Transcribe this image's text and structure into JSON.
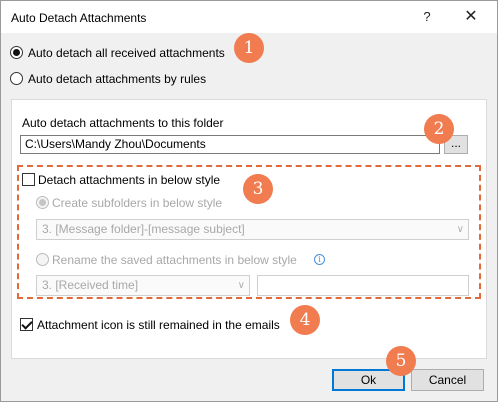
{
  "window": {
    "title": "Auto Detach Attachments",
    "help_glyph": "?",
    "close_glyph": "✕"
  },
  "options": {
    "all_received": "Auto detach all received attachments",
    "by_rules": "Auto detach attachments by rules"
  },
  "folder": {
    "label": "Auto detach attachments to this folder",
    "path": "C:\\Users\\Mandy Zhou\\Documents",
    "browse_label": "..."
  },
  "style": {
    "checkbox_label": "Detach attachments in below style",
    "create_subfolders_label": "Create subfolders in below style",
    "subfolder_select_value": "3. [Message folder]-[message subject]",
    "rename_label": "Rename the saved attachments in below style",
    "rename_select_value": "3. [Received time]",
    "rename_extra_value": ""
  },
  "icon_option": {
    "label": "Attachment icon is still remained in the emails"
  },
  "buttons": {
    "ok": "Ok",
    "cancel": "Cancel"
  },
  "callouts": [
    "1",
    "2",
    "3",
    "4",
    "5"
  ],
  "colors": {
    "callout": "#f07c50",
    "dashed_border": "#e06a3a",
    "accent": "#0078d7"
  }
}
